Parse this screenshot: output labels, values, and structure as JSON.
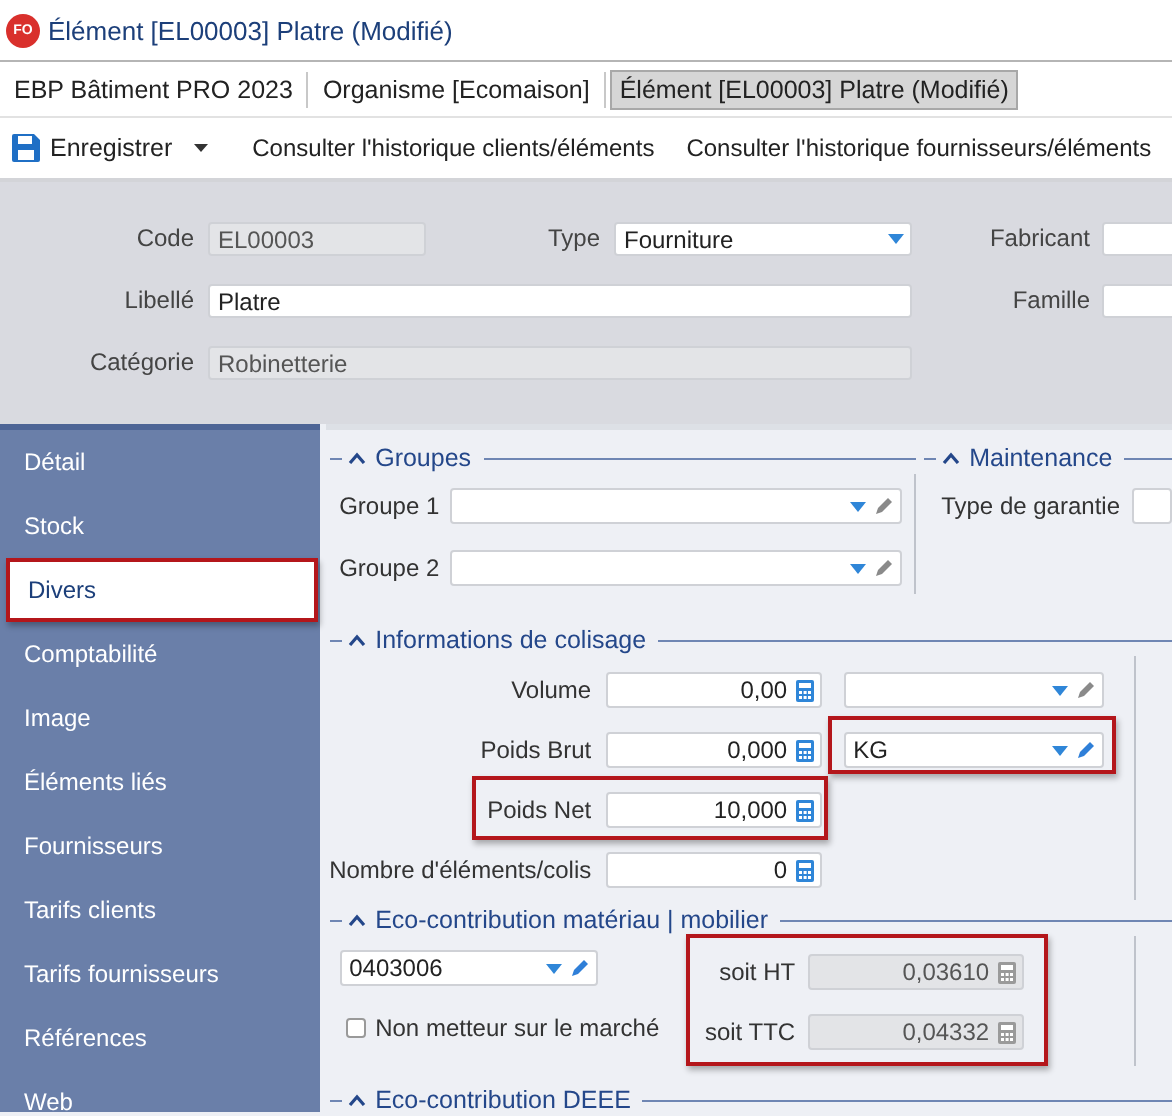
{
  "window": {
    "badge": "FO",
    "title": "Élément [EL00003] Platre (Modifié)"
  },
  "breadcrumb": [
    {
      "label": "EBP Bâtiment PRO 2023",
      "selected": false
    },
    {
      "label": "Organisme [Ecomaison]",
      "selected": false
    },
    {
      "label": "Élément [EL00003] Platre (Modifié)",
      "selected": true
    }
  ],
  "toolbar": [
    {
      "kind": "save",
      "label": "Enregistrer"
    },
    {
      "kind": "link",
      "label": "Consulter l'historique clients/éléments"
    },
    {
      "kind": "link",
      "label": "Consulter l'historique fournisseurs/éléments"
    }
  ],
  "header": {
    "code": {
      "label": "Code",
      "value": "EL00003",
      "disabled": true
    },
    "type": {
      "label": "Type",
      "value": "Fourniture",
      "disabled": false
    },
    "fabricant": {
      "label": "Fabricant",
      "disabled": false
    },
    "libelle": {
      "label": "Libellé",
      "value": "Platre",
      "disabled": false
    },
    "famille": {
      "label": "Famille",
      "disabled": false
    },
    "categorie": {
      "label": "Catégorie",
      "value": "Robinetterie",
      "disabled": true
    }
  },
  "sidebar": {
    "items": [
      {
        "label": "Détail",
        "selected": false,
        "highlighted": false
      },
      {
        "label": "Stock",
        "selected": false,
        "highlighted": false
      },
      {
        "label": "Divers",
        "selected": true,
        "highlighted": true
      },
      {
        "label": "Comptabilité",
        "selected": false,
        "highlighted": false
      },
      {
        "label": "Image",
        "selected": false,
        "highlighted": false
      },
      {
        "label": "Éléments liés",
        "selected": false,
        "highlighted": false
      },
      {
        "label": "Fournisseurs",
        "selected": false,
        "highlighted": false
      },
      {
        "label": "Tarifs clients",
        "selected": false,
        "highlighted": false
      },
      {
        "label": "Tarifs fournisseurs",
        "selected": false,
        "highlighted": false
      },
      {
        "label": "Références",
        "selected": false,
        "highlighted": false
      },
      {
        "label": "Web",
        "selected": false,
        "highlighted": false
      }
    ]
  },
  "groupes": {
    "title": "Groupes",
    "fields": [
      {
        "label": "Groupe 1"
      },
      {
        "label": "Groupe 2"
      }
    ]
  },
  "maintenance": {
    "title": "Maintenance",
    "fields": [
      {
        "label": "Type de garantie"
      }
    ]
  },
  "colisage": {
    "title": "Informations de colisage",
    "rows": [
      {
        "label": "Volume",
        "value": "0,00",
        "highlighted": false,
        "unit": {
          "highlighted": false
        }
      },
      {
        "label": "Poids Brut",
        "value": "0,000",
        "highlighted": false,
        "unit": {
          "value": "KG",
          "highlighted": true
        }
      },
      {
        "label": "Poids Net",
        "value": "10,000",
        "highlighted": true
      },
      {
        "label": "Nombre d'éléments/colis",
        "value": "0",
        "highlighted": false
      }
    ]
  },
  "eco_mobilier": {
    "title": "Eco-contribution matériau | mobilier",
    "code": "0403006",
    "checkbox": {
      "label": "Non metteur sur le marché",
      "checked": false
    },
    "amounts_highlighted": true,
    "amounts": [
      {
        "label": "soit HT",
        "value": "0,03610"
      },
      {
        "label": "soit TTC",
        "value": "0,04332"
      }
    ]
  },
  "eco_deee": {
    "title": "Eco-contribution DEEE"
  }
}
